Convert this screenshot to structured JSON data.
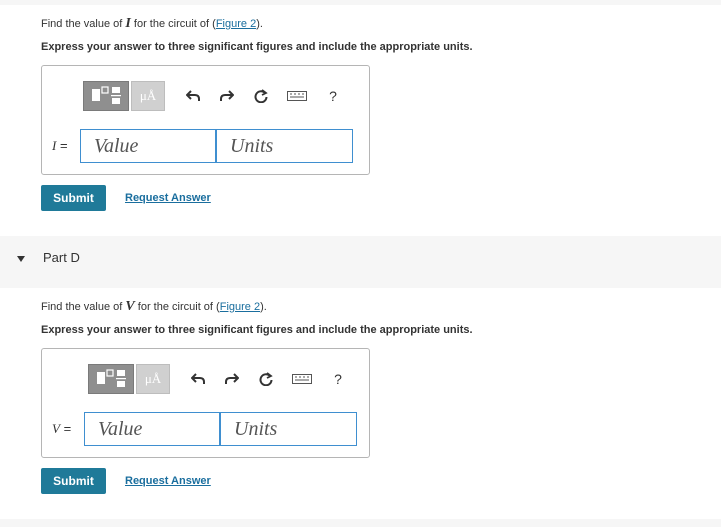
{
  "partC": {
    "question_prefix": "Find the value of ",
    "question_var": "I",
    "question_mid": " for the circuit of (",
    "figure_link": "Figure 2",
    "question_suffix": ").",
    "instruction": "Express your answer to three significant figures and include the appropriate units.",
    "var_label": "I",
    "equals": " =",
    "value_placeholder": "Value",
    "units_placeholder": "Units",
    "submit": "Submit",
    "request_answer": "Request Answer"
  },
  "partD": {
    "title": "Part D",
    "question_prefix": "Find the value of ",
    "question_var": "V",
    "question_mid": " for the circuit of (",
    "figure_link": "Figure 2",
    "question_suffix": ").",
    "instruction": "Express your answer to three significant figures and include the appropriate units.",
    "var_label": "V",
    "equals": " =",
    "value_placeholder": "Value",
    "units_placeholder": "Units",
    "submit": "Submit",
    "request_answer": "Request Answer"
  },
  "toolbar": {
    "units_symbol": "μÅ",
    "help": "?",
    "icons": [
      "templates-icon",
      "units-icon",
      "undo-icon",
      "redo-icon",
      "reset-icon",
      "keyboard-icon",
      "help-icon"
    ]
  },
  "colors": {
    "accent": "#1f7a99",
    "link": "#1a6e9e",
    "field_border": "#3f8fd0"
  }
}
